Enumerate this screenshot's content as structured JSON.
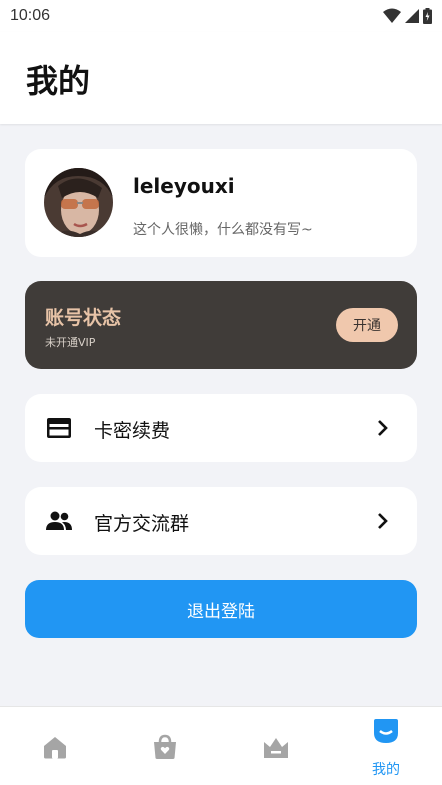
{
  "status_bar": {
    "time": "10:06"
  },
  "header": {
    "title": "我的"
  },
  "profile": {
    "username": "leleyouxi",
    "bio": "这个人很懒，什么都没有写~"
  },
  "vip": {
    "title": "账号状态",
    "subtitle": "未开通VIP",
    "button_label": "开通"
  },
  "menu": [
    {
      "label": "卡密续费",
      "icon": "credit-card-icon"
    },
    {
      "label": "官方交流群",
      "icon": "group-icon"
    }
  ],
  "logout_label": "退出登陆",
  "tabbar": {
    "tabs": [
      {
        "icon": "home-icon",
        "label": ""
      },
      {
        "icon": "shopping-bag-icon",
        "label": ""
      },
      {
        "icon": "crown-icon",
        "label": ""
      },
      {
        "icon": "profile-icon",
        "label": "我的",
        "active": true
      }
    ]
  },
  "colors": {
    "accent": "#2196f3",
    "vip_card": "#403c39",
    "vip_title": "#e7c3a7",
    "vip_button": "#f0c8ad",
    "page_bg": "#f2f3f7",
    "tab_inactive": "#a5a5a5"
  }
}
